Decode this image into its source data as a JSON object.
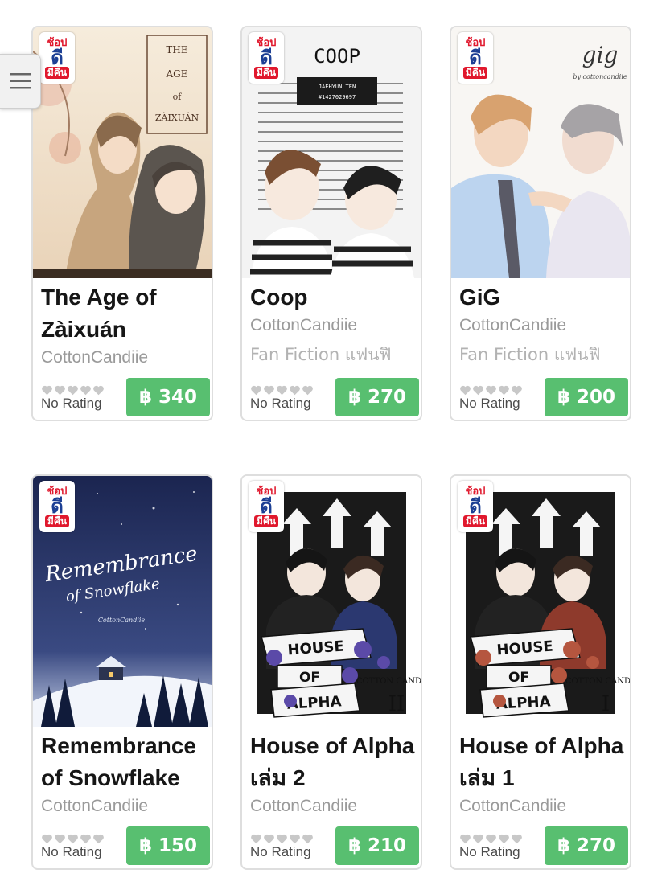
{
  "menu": {
    "icon": "hamburger-icon"
  },
  "badge": {
    "line1": "ช้อป",
    "line2": "ดี",
    "line3": "มีคืน"
  },
  "books": [
    {
      "title": "The Age of Zàixuán",
      "author": "CottonCandiie",
      "genre": "",
      "rating": "No Rating",
      "price": "฿ 340",
      "cover_text": "THE AGE of ZÀIXUÁN",
      "badge": true
    },
    {
      "title": "Coop",
      "author": "CottonCandiie",
      "genre": "Fan Fiction แฟนฟิ",
      "rating": "No Rating",
      "price": "฿ 270",
      "cover_text": "COOP",
      "cover_sub1": "JAEHYUN TEN",
      "cover_sub2": "#1427029697",
      "badge": true
    },
    {
      "title": "GiG",
      "author": "CottonCandiie",
      "genre": "Fan Fiction แฟนฟิ",
      "rating": "No Rating",
      "price": "฿ 200",
      "cover_text": "gig",
      "cover_sub1": "by cottoncandiie",
      "badge": true
    },
    {
      "title": "Remembrance of Snowflake",
      "author": "CottonCandiie",
      "genre": "",
      "rating": "No Rating",
      "price": "฿ 150",
      "cover_text": "Remembrance",
      "cover_sub1": "of Snowflake",
      "cover_sub2": "CottonCandiie",
      "badge": true
    },
    {
      "title": "House of Alpha เล่ม 2",
      "author": "CottonCandiie",
      "genre": "",
      "rating": "No Rating",
      "price": "฿ 210",
      "cover_text": "HOUSE OF ALPHA",
      "cover_sub1": "II",
      "cover_sub2": "COTTON CANDIIE",
      "badge": true
    },
    {
      "title": "House of Alpha เล่ม 1",
      "author": "CottonCandiie",
      "genre": "",
      "rating": "No Rating",
      "price": "฿ 270",
      "cover_text": "HOUSE OF ALPHA",
      "cover_sub1": "I",
      "cover_sub2": "COTTON CANDIIE",
      "badge": true
    }
  ],
  "colors": {
    "price_bg": "#58bf70",
    "star": "#c8c8c8",
    "badge_red": "#e0182d",
    "badge_blue": "#1c3f94"
  }
}
